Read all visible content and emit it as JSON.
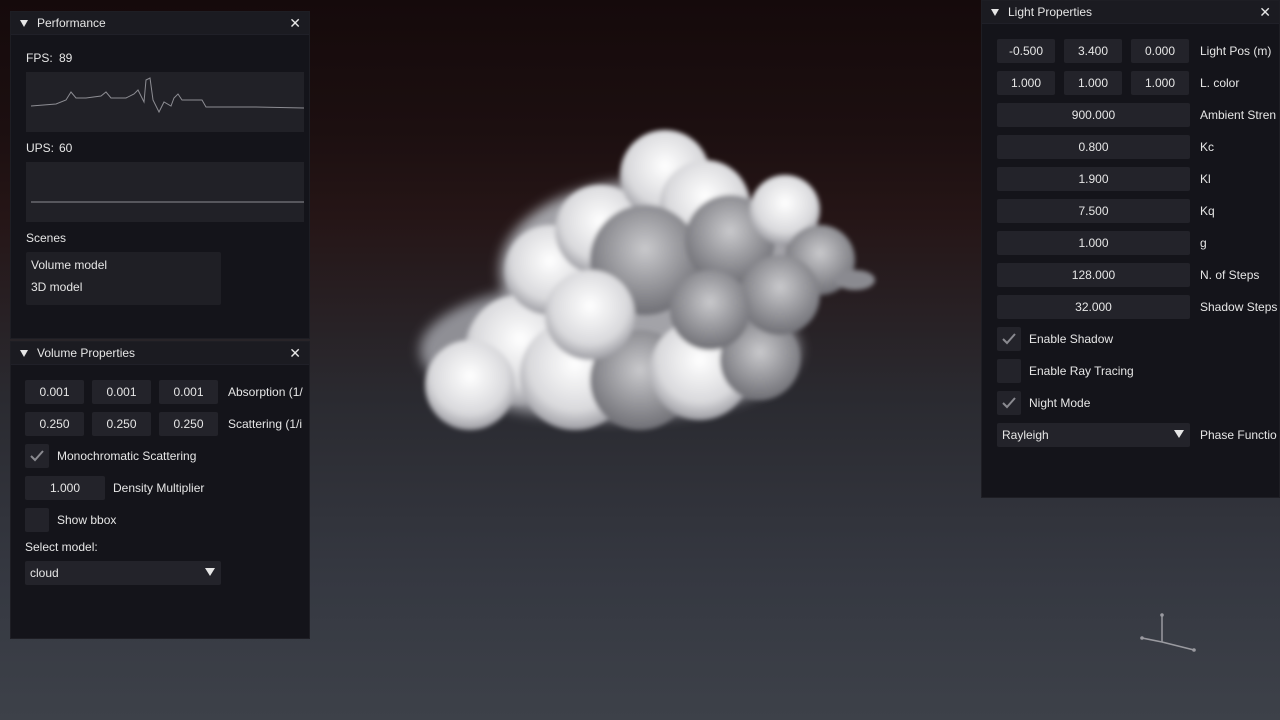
{
  "performance": {
    "title": "Performance",
    "fps_label": "FPS:",
    "fps_value": "89",
    "ups_label": "UPS:",
    "ups_value": "60",
    "scenes_label": "Scenes",
    "scenes": [
      "Volume model",
      "3D model"
    ]
  },
  "volume": {
    "title": "Volume Properties",
    "absorption": [
      "0.001",
      "0.001",
      "0.001"
    ],
    "absorption_label": "Absorption (1/",
    "scattering": [
      "0.250",
      "0.250",
      "0.250"
    ],
    "scattering_label": "Scattering (1/i",
    "mono_label": "Monochromatic Scattering",
    "mono_checked": true,
    "density_value": "1.000",
    "density_label": "Density Multiplier",
    "bbox_label": "Show bbox",
    "bbox_checked": false,
    "select_model_label": "Select model:",
    "model_value": "cloud"
  },
  "light": {
    "title": "Light Properties",
    "light_pos": [
      "-0.500",
      "3.400",
      "0.000"
    ],
    "light_pos_label": "Light Pos (m)",
    "color": [
      "1.000",
      "1.000",
      "1.000"
    ],
    "color_label": "L. color",
    "ambient_value": "900.000",
    "ambient_label": "Ambient Stren",
    "kc_value": "0.800",
    "kc_label": "Kc",
    "kl_value": "1.900",
    "kl_label": "Kl",
    "kq_value": "7.500",
    "kq_label": "Kq",
    "g_value": "1.000",
    "g_label": "g",
    "steps_value": "128.000",
    "steps_label": "N. of Steps",
    "shadow_steps_value": "32.000",
    "shadow_steps_label": "Shadow Steps",
    "enable_shadow_label": "Enable Shadow",
    "enable_shadow_checked": true,
    "ray_tracing_label": "Enable Ray Tracing",
    "ray_tracing_checked": false,
    "night_mode_label": "Night Mode",
    "night_mode_checked": true,
    "phase_value": "Rayleigh",
    "phase_label": "Phase Functio"
  },
  "icons": {
    "close": "close-icon",
    "collapse": "collapse-triangle-icon",
    "check": "checkmark-icon",
    "dropdown": "dropdown-arrow-icon",
    "gizmo": "axis-gizmo-icon"
  }
}
